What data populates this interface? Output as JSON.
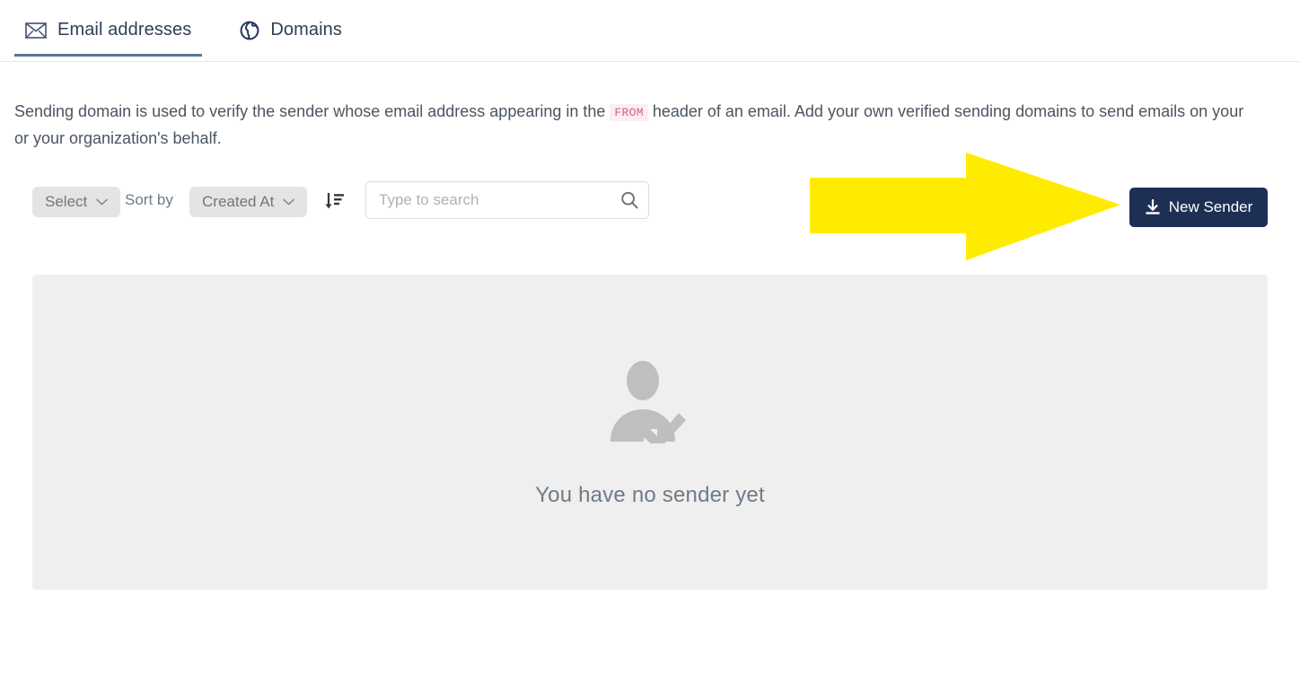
{
  "tabs": [
    {
      "id": "email-addresses",
      "label": "Email addresses",
      "icon": "mail-icon",
      "active": true
    },
    {
      "id": "domains",
      "label": "Domains",
      "icon": "globe-icon",
      "active": false
    }
  ],
  "description": {
    "part1": "Sending domain is used to verify the sender whose email address appearing in the ",
    "code": "FROM",
    "part2": " header of an email. Add your own verified sending domains to send emails on your or your organization's behalf."
  },
  "toolbar": {
    "select_label": "Select",
    "sort_by_label": "Sort by",
    "sort_field_label": "Created At",
    "sort_direction_icon": "sort-descending-icon",
    "search_placeholder": "Type to search",
    "search_value": "",
    "search_icon": "search-icon",
    "new_sender_label": "New Sender",
    "new_sender_icon": "download-icon"
  },
  "empty_state": {
    "icon": "user-check-icon",
    "message": "You have no sender yet"
  },
  "annotation": {
    "type": "arrow",
    "direction": "right",
    "color": "#ffeb00",
    "points_to": "New Sender"
  },
  "colors": {
    "accent": "#5a7596",
    "primary_button": "#1d3054",
    "tab_text": "#2f3e55",
    "body_text": "#4b5561",
    "panel_bg": "#efefef",
    "pill_bg": "#e4e4e4",
    "code_text": "#d6607f",
    "code_bg": "#fbeef2",
    "highlight": "#ffeb00"
  }
}
